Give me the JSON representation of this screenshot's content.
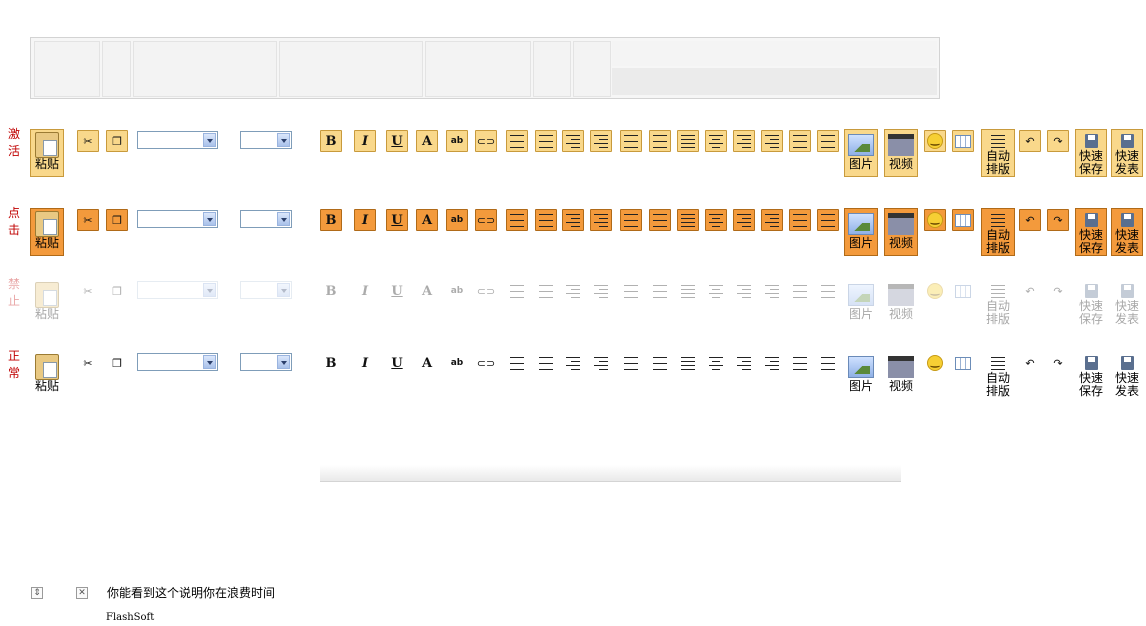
{
  "rows": [
    {
      "label": [
        "激",
        "活"
      ],
      "state": "hover"
    },
    {
      "label": [
        "点",
        "击"
      ],
      "state": "active"
    },
    {
      "label": [
        "禁",
        "止"
      ],
      "state": "disabled"
    },
    {
      "label": [
        "正",
        "常"
      ],
      "state": "normal"
    }
  ],
  "toolbar": {
    "paste": "粘贴",
    "bold": "B",
    "italic": "I",
    "underline": "U",
    "font_color": "A",
    "highlight": "ab",
    "image": "图片",
    "video": "视频",
    "auto_format": "自动\n排版",
    "quick_save": "快速\n保存",
    "quick_publish": "快速\n发表"
  },
  "footer": {
    "note": "你能看到这个说明你在浪费时间",
    "credit": "FlashSoft"
  },
  "colors": {
    "label_red": "#c00000",
    "hover_fill": "#f9d88b",
    "active_fill": "#f39a3c"
  }
}
